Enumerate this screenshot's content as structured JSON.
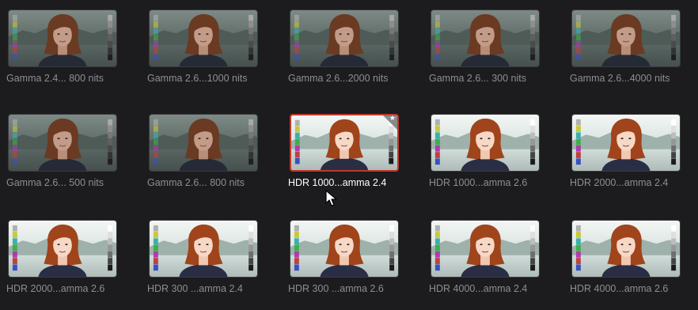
{
  "clips": [
    {
      "label": "Gamma 2.4... 800 nits",
      "style": "sdr",
      "selected": false
    },
    {
      "label": "Gamma 2.6...1000 nits",
      "style": "sdr",
      "selected": false
    },
    {
      "label": "Gamma 2.6...2000 nits",
      "style": "sdr",
      "selected": false
    },
    {
      "label": "Gamma 2.6... 300 nits",
      "style": "sdr",
      "selected": false
    },
    {
      "label": "Gamma 2.6...4000 nits",
      "style": "sdr",
      "selected": false
    },
    {
      "label": "Gamma 2.6... 500 nits",
      "style": "sdr",
      "selected": false
    },
    {
      "label": "Gamma 2.6... 800 nits",
      "style": "sdr",
      "selected": false
    },
    {
      "label": "HDR 1000...amma 2.4",
      "style": "hdr",
      "selected": true
    },
    {
      "label": "HDR 1000...amma 2.6",
      "style": "hdr",
      "selected": false
    },
    {
      "label": "HDR 2000...amma 2.4",
      "style": "hdr",
      "selected": false
    },
    {
      "label": "HDR 2000...amma 2.6",
      "style": "hdr",
      "selected": false
    },
    {
      "label": "HDR 300 ...amma 2.4",
      "style": "hdr",
      "selected": false
    },
    {
      "label": "HDR 300 ...amma 2.6",
      "style": "hdr",
      "selected": false
    },
    {
      "label": "HDR 4000...amma 2.4",
      "style": "hdr",
      "selected": false
    },
    {
      "label": "HDR 4000...amma 2.6",
      "style": "hdr",
      "selected": false
    }
  ],
  "icons": {
    "favorite": "star-icon",
    "pointer": "mouse-pointer-icon"
  },
  "colors": {
    "background": "#1c1c1e",
    "selection_border": "#c0392b",
    "label_text": "#8e8e93",
    "selected_label_text": "#ffffff"
  }
}
